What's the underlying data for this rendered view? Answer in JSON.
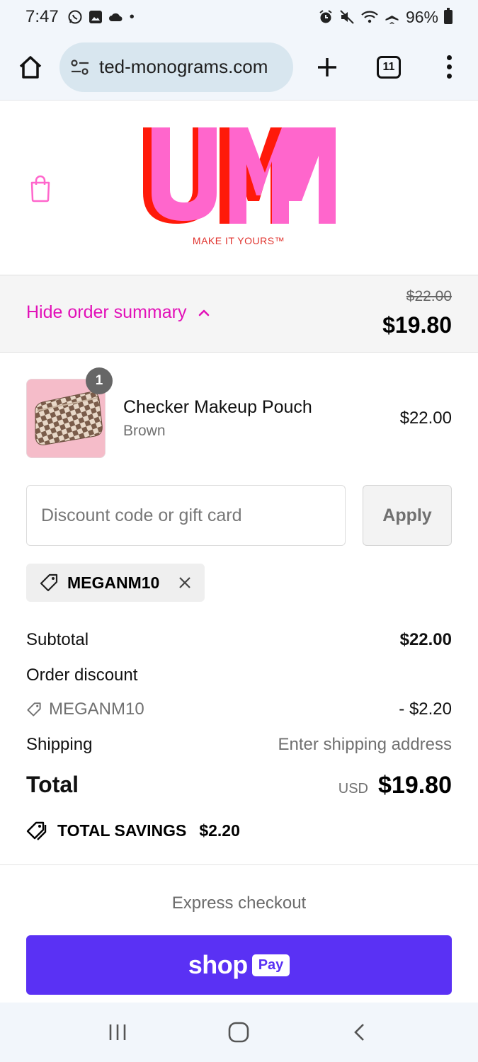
{
  "status_bar": {
    "time": "7:47",
    "battery": "96%"
  },
  "browser": {
    "url": "ted-monograms.com",
    "tab_count": "11"
  },
  "store": {
    "logo_text": "UM",
    "tagline": "MAKE IT YOURS™",
    "brand_pink": "#ff66cc",
    "brand_red": "#ff1a0a"
  },
  "summary_bar": {
    "toggle_label": "Hide order summary",
    "original_total": "$22.00",
    "total": "$19.80",
    "accent": "#e211b8"
  },
  "line_item": {
    "quantity": "1",
    "name": "Checker Makeup Pouch",
    "variant": "Brown",
    "price": "$22.00"
  },
  "discount": {
    "placeholder": "Discount code or gift card",
    "apply_label": "Apply",
    "applied_code": "MEGANM10"
  },
  "totals": {
    "subtotal_label": "Subtotal",
    "subtotal_value": "$22.00",
    "order_discount_label": "Order discount",
    "discount_code": "MEGANM10",
    "discount_value": "- $2.20",
    "shipping_label": "Shipping",
    "shipping_value": "Enter shipping address",
    "total_label": "Total",
    "currency": "USD",
    "total_value": "$19.80",
    "savings_label": "TOTAL SAVINGS",
    "savings_value": "$2.20"
  },
  "express": {
    "label": "Express checkout",
    "shop_text": "shop",
    "pay_text": "Pay",
    "button_color": "#5a31f4"
  },
  "icons": [
    "home-icon",
    "tune-icon",
    "plus-icon",
    "tabs-icon",
    "more-icon",
    "bag-icon",
    "chevron-up-icon",
    "tag-icon",
    "close-icon",
    "savings-tag-icon",
    "recents-icon",
    "home-circle-icon",
    "back-icon"
  ]
}
